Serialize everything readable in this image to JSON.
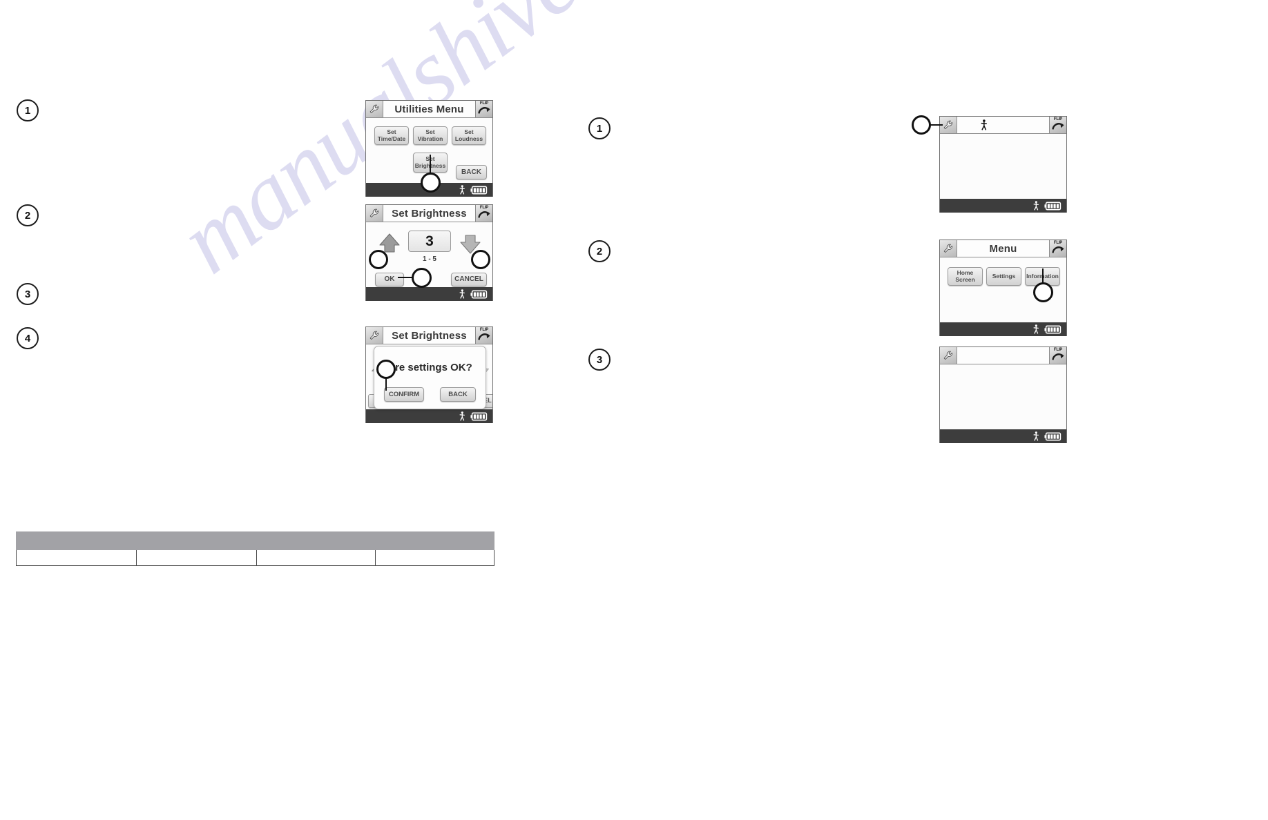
{
  "page": {
    "watermark": "manualshive.com"
  },
  "left_column": {
    "steps": [
      {
        "number": "1"
      },
      {
        "number": "2"
      },
      {
        "number": "3"
      },
      {
        "number": "4"
      }
    ],
    "screens": [
      {
        "id": "utilities-menu",
        "title": "Utilities Menu",
        "wrench_icon": "wrench-icon",
        "flip_icon": "flip-icon",
        "flip_label": "FLIP",
        "status_person_icon": "walking-person-icon",
        "status_battery_icon": "battery-full-icon",
        "buttons": [
          {
            "label": "Set\nTime/Date",
            "name": "set-time-date-button"
          },
          {
            "label": "Set\nVibration",
            "name": "set-vibration-button"
          },
          {
            "label": "Set\nLoudness",
            "name": "set-loudness-button"
          },
          {
            "label": "Set\nBrightness",
            "name": "set-brightness-button"
          },
          {
            "label": "BACK",
            "name": "back-button"
          }
        ]
      },
      {
        "id": "set-brightness",
        "title": "Set Brightness",
        "wrench_icon": "wrench-icon",
        "flip_icon": "flip-icon",
        "flip_label": "FLIP",
        "value": "3",
        "range_label": "1 - 5",
        "increase_icon": "arrow-up-icon",
        "decrease_icon": "arrow-down-icon",
        "status_person_icon": "walking-person-icon",
        "status_battery_icon": "battery-full-icon",
        "buttons": [
          {
            "label": "OK",
            "name": "ok-button"
          },
          {
            "label": "CANCEL",
            "name": "cancel-button"
          }
        ]
      },
      {
        "id": "set-brightness-confirm",
        "title": "Set Brightness",
        "wrench_icon": "wrench-icon",
        "flip_icon": "flip-icon",
        "flip_label": "FLIP",
        "dialog_text": "Are settings OK?",
        "behind_left_label": "",
        "behind_right_label": "EL",
        "status_person_icon": "walking-person-icon",
        "status_battery_icon": "battery-full-icon",
        "buttons": [
          {
            "label": "CONFIRM",
            "name": "confirm-button"
          },
          {
            "label": "BACK",
            "name": "back-button"
          }
        ]
      }
    ]
  },
  "right_column": {
    "steps": [
      {
        "number": "1"
      },
      {
        "number": "2"
      },
      {
        "number": "3"
      }
    ],
    "screens": [
      {
        "id": "home-screen",
        "title": "",
        "wrench_icon": "wrench-icon",
        "flip_icon": "flip-icon",
        "flip_label": "FLIP",
        "header_person_icon": "walking-person-icon",
        "status_person_icon": "walking-person-icon",
        "status_battery_icon": "battery-full-icon",
        "buttons": []
      },
      {
        "id": "menu",
        "title": "Menu",
        "wrench_icon": "wrench-icon",
        "flip_icon": "flip-icon",
        "flip_label": "FLIP",
        "status_person_icon": "walking-person-icon",
        "status_battery_icon": "battery-full-icon",
        "buttons": [
          {
            "label": "Home\nScreen",
            "name": "home-screen-button"
          },
          {
            "label": "Settings",
            "name": "settings-button"
          },
          {
            "label": "Information",
            "name": "information-button"
          }
        ]
      },
      {
        "id": "blank-screen",
        "title": "",
        "wrench_icon": "wrench-icon",
        "flip_icon": "flip-icon",
        "flip_label": "FLIP",
        "status_person_icon": "walking-person-icon",
        "status_battery_icon": "battery-full-icon",
        "buttons": []
      }
    ]
  },
  "table": {
    "columns": [
      "",
      "",
      "",
      ""
    ],
    "header_row": [
      "",
      "",
      "",
      ""
    ],
    "rows": [
      [
        "",
        "",
        "",
        ""
      ]
    ],
    "header_color": "#a2a2a6"
  }
}
